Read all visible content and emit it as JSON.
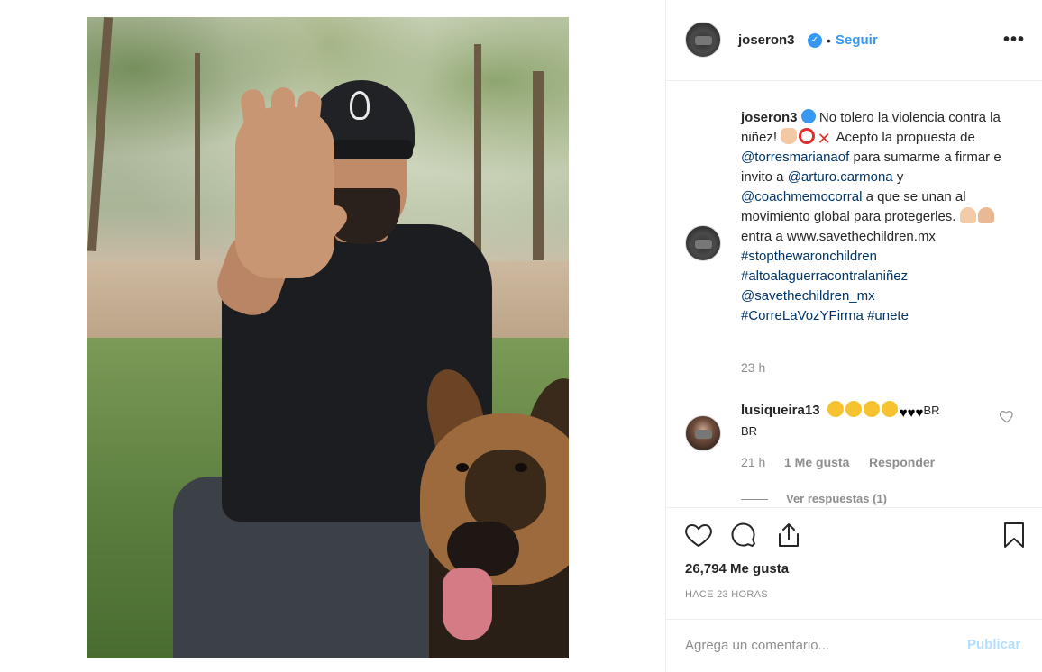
{
  "header": {
    "username": "joseron3",
    "dot": "•",
    "follow_label": "Seguir",
    "more_label": "•••"
  },
  "caption": {
    "username": "joseron3",
    "t1": " No tolero la violencia contra la niñez! ",
    "t2": " Acepto la propuesta de ",
    "mention1": "@torresmarianaof",
    "t3": " para sumarme a firmar e invito a ",
    "mention2": "@arturo.carmona",
    "t4": " y ",
    "mention3": "@coachmemocorral",
    "t5": " a que se unan al movimiento global para protegerles. ",
    "t6": " entra a www.savethechildren.mx ",
    "hashtag1": "#stopthewaronchildren",
    "hashtag2": "#altoalaguerracontralaniñez",
    "mention4": "@savethechildren_mx",
    "hashtag3": "#CorreLaVozYFirma",
    "hashtag4": "#unete",
    "time": "23 h"
  },
  "comment": {
    "username": "lusiqueira13",
    "tail1": "BR",
    "tail2": "BR",
    "time": "21 h",
    "likes": "1 Me gusta",
    "reply": "Responder",
    "view_replies": "Ver respuestas (1)"
  },
  "stats": {
    "likes": "26,794 Me gusta",
    "ago": "HACE 23 HORAS"
  },
  "add_comment": {
    "placeholder": "Agrega un comentario...",
    "publish": "Publicar"
  },
  "colors": {
    "accent": "#3897f0",
    "link": "#003569",
    "muted": "#8e8e8e",
    "publish_disabled": "#b2dffc"
  }
}
